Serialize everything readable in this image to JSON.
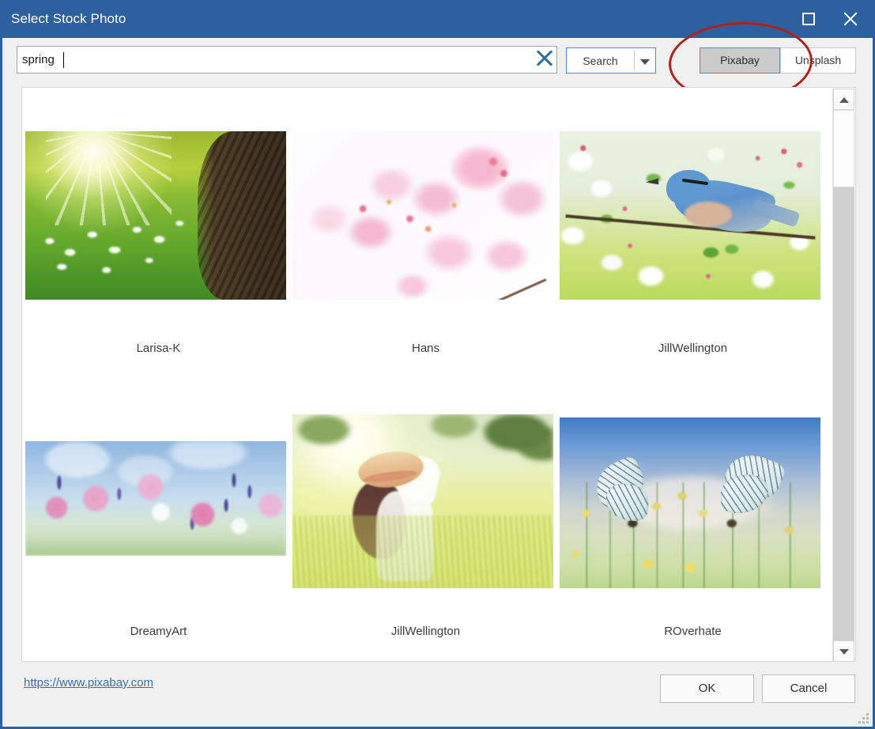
{
  "window": {
    "title": "Select Stock Photo",
    "maximize_icon": "maximize-square-icon",
    "close_icon": "close-x-icon"
  },
  "search": {
    "value": "spring",
    "placeholder": "",
    "clear_icon": "clear-x-icon",
    "button_label": "Search",
    "dropdown_icon": "chevron-down-icon"
  },
  "providers": {
    "selected": "Pixabay",
    "options": [
      {
        "label": "Pixabay",
        "active": true
      },
      {
        "label": "Unsplash",
        "active": false
      }
    ]
  },
  "annotation": {
    "shape": "ellipse",
    "color": "#b41f17",
    "target": "provider-toggle-group"
  },
  "results": {
    "rows": [
      [
        {
          "author": "Larisa-K",
          "alt": "sunlit green meadow with white flowers and tree trunk"
        },
        {
          "author": "Hans",
          "alt": "pink cherry blossom branch on white background"
        },
        {
          "author": "JillWellington",
          "alt": "blue nuthatch bird perched on blossoming branch"
        }
      ],
      [
        {
          "author": "DreamyArt",
          "alt": "watercolour pink cosmos flowers under blue sky"
        },
        {
          "author": "JillWellington",
          "alt": "woman in straw hat standing in sunlit meadow"
        },
        {
          "author": "ROverhate",
          "alt": "two white butterflies on yellow flowers with blue sky"
        }
      ]
    ]
  },
  "scrollbar": {
    "up_icon": "scroll-up-arrow-icon",
    "down_icon": "scroll-down-arrow-icon",
    "position": "top"
  },
  "footer": {
    "source_url": "https://www.pixabay.com",
    "ok_label": "OK",
    "cancel_label": "Cancel",
    "resize_grip_icon": "resize-grip-icon"
  },
  "colors": {
    "titlebar": "#2e5f9e",
    "accent": "#4a90d9",
    "annotation": "#b41f17",
    "link": "#3f6fa8",
    "active_button": "#cbcbcb"
  }
}
